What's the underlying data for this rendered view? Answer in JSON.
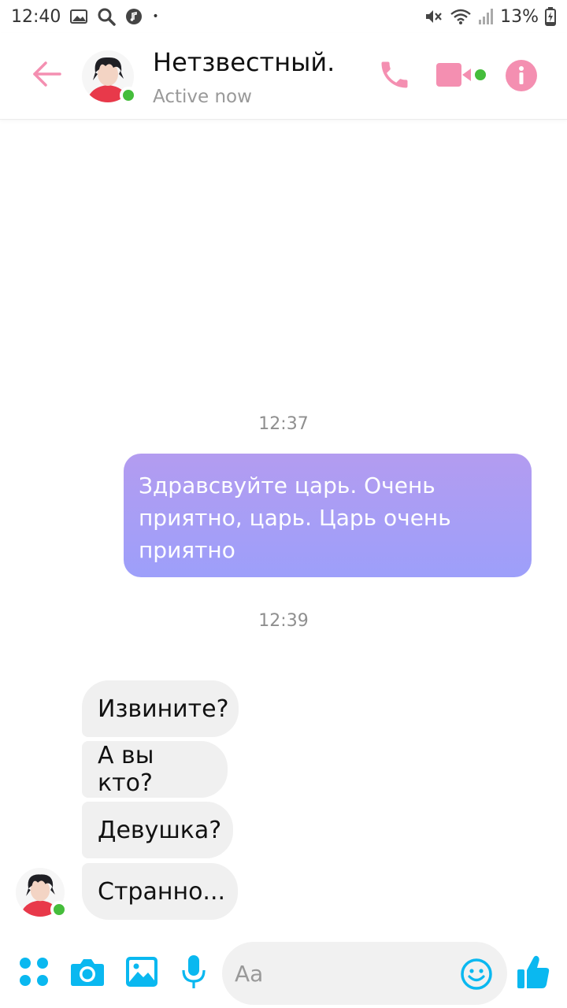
{
  "status_bar": {
    "time": "12:40",
    "battery": "13%",
    "dot": "•"
  },
  "header": {
    "contact_name": "Нетзвестный.",
    "status": "Active now"
  },
  "messages": {
    "timestamp_1": "12:37",
    "outgoing_text": "Здравсвуйте царь. Очень приятно, царь. Царь очень приятно",
    "timestamp_2": "12:39",
    "incoming": [
      "Извините?",
      "А вы кто?",
      "Девушка?",
      "Странно..."
    ]
  },
  "composer": {
    "placeholder": "Aa"
  },
  "colors": {
    "accent_pink": "#f48fb1",
    "accent_blue": "#0ab8f0",
    "online_green": "#45bd3b",
    "bubble_gradient_top": "#b39cf0",
    "bubble_gradient_bottom": "#9d9ffa",
    "incoming_bubble": "#f0f0f0"
  },
  "icons": {
    "status_left": [
      "gallery-icon",
      "search-icon",
      "music-icon"
    ],
    "status_right": [
      "mute-icon",
      "wifi-icon",
      "signal-icon",
      "battery-charging-icon"
    ],
    "header": [
      "back-arrow-icon",
      "phone-icon",
      "video-camera-icon",
      "info-icon"
    ],
    "composer": [
      "apps-grid-icon",
      "camera-icon",
      "image-icon",
      "microphone-icon",
      "emoji-icon",
      "thumbs-up-icon"
    ]
  }
}
